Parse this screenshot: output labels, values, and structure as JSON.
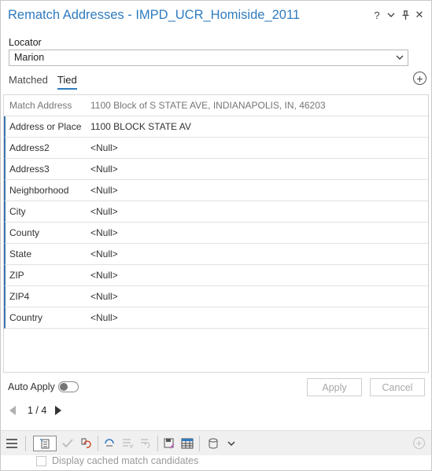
{
  "window": {
    "title": "Rematch Addresses - IMPD_UCR_Homiside_2011",
    "controls": [
      "help-icon",
      "menu-chevron-icon",
      "pin-icon",
      "close-icon"
    ],
    "help_label": "?",
    "close_label": "✕"
  },
  "locator": {
    "label": "Locator",
    "value": "Marion"
  },
  "tabs": [
    {
      "label": "Matched",
      "active": false
    },
    {
      "label": "Tied",
      "active": true
    }
  ],
  "table": {
    "header": {
      "key": "Match Address",
      "value": "1100 Block of S STATE AVE, INDIANAPOLIS, IN, 46203"
    },
    "rows": [
      {
        "key": "Address or Place",
        "value": "1100 BLOCK STATE AV"
      },
      {
        "key": "Address2",
        "value": "<Null>"
      },
      {
        "key": "Address3",
        "value": "<Null>"
      },
      {
        "key": "Neighborhood",
        "value": "<Null>"
      },
      {
        "key": "City",
        "value": "<Null>"
      },
      {
        "key": "County",
        "value": "<Null>"
      },
      {
        "key": "State",
        "value": "<Null>"
      },
      {
        "key": "ZIP",
        "value": "<Null>"
      },
      {
        "key": "ZIP4",
        "value": "<Null>"
      },
      {
        "key": "Country",
        "value": "<Null>"
      }
    ]
  },
  "auto_apply": {
    "label": "Auto Apply",
    "on": false
  },
  "buttons": {
    "apply": "Apply",
    "cancel": "Cancel"
  },
  "pager": {
    "text": "1 / 4"
  },
  "options": {
    "display_cached": "Display cached match candidates"
  },
  "colors": {
    "accent": "#2f7bbf",
    "row_marker": "#3b73b0"
  }
}
